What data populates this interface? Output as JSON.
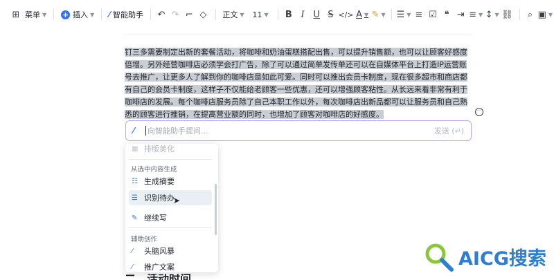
{
  "toolbar": {
    "menu_label": "菜单",
    "insert_label": "插入",
    "ai_assistant_label": "智能助手",
    "text_style": "正文",
    "font_size": "11",
    "icons": [
      "undo-icon",
      "redo-icon",
      "format-painter-icon",
      "eraser-icon",
      "bold-icon",
      "italic-icon",
      "underline-icon",
      "strikethrough-icon",
      "code-icon",
      "font-color-icon",
      "highlight-icon",
      "bullet-list-icon",
      "numbered-list-icon",
      "checkbox-icon",
      "quote-icon",
      "indent-icon",
      "align-icon",
      "line-spacing-icon",
      "link-icon",
      "find-icon",
      "image-icon"
    ]
  },
  "document": {
    "paragraph": "钉三多需要制定出新的套餐活动，将咖啡和奶油蛋糕搭配出售，可以提升销售额，也可以让顾客好感度倍增。另外经营咖啡店必须学会打广告，除了可以通过简单发传单还可以在自媒体平台上打造IP运营账号去推广，让更多人了解到你的咖啡店是如此可爱。同时可以推出会员卡制度，现在很多超市和商店都有自己的会员卡制度，这样子不仅能给老顾客一些优惠，还可以增强顾客粘性。从长远来看非常有利于咖啡店的发展。每个咖啡店服务员除了自己本职工作以外，每次咖啡店出新品都可以让服务员和自己熟悉的顾客进行推销，在提高营业额的同时，也增加了顾客对咖啡店的好感度。",
    "heading": "二、活动时间"
  },
  "ai_bar": {
    "placeholder": "向智能助手提问...",
    "send_label": "发送 (↵)"
  },
  "menu": {
    "top_item": "排版美化",
    "section1_header": "从选中内容生成",
    "section1_items": [
      "生成摘要",
      "识别待办",
      "继续写"
    ],
    "section2_header": "辅助创作",
    "section2_items": [
      "头脑风暴",
      "推广文案"
    ]
  },
  "watermark": {
    "text": "AICG搜索"
  },
  "colors": {
    "accent": "#3370ff",
    "ai_border": "#b9a8f5",
    "selection": "#c9cdd4",
    "watermark": "#2e7fd4"
  }
}
